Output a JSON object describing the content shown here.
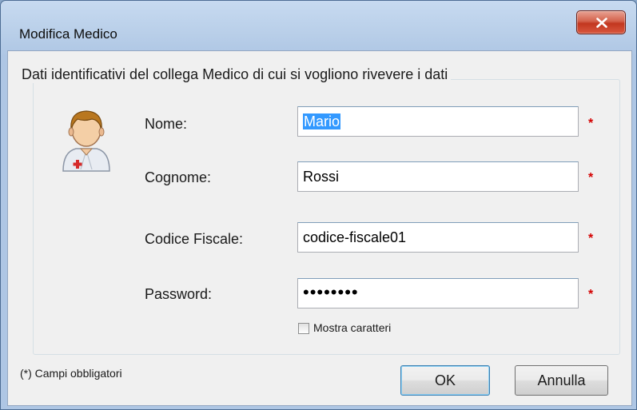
{
  "window": {
    "title": "Modifica Medico",
    "close_glyph": "X"
  },
  "group": {
    "title": "Dati identificativi del collega Medico di cui si vogliono rivevere i dati"
  },
  "avatar": {
    "icon": "doctor-avatar-icon"
  },
  "form": {
    "nome": {
      "label": "Nome:",
      "value": "Mario",
      "selected": true,
      "required_mark": "*"
    },
    "cognome": {
      "label": "Cognome:",
      "value": "Rossi",
      "required_mark": "*"
    },
    "codice_fiscale": {
      "label": "Codice Fiscale:",
      "value": "codice-fiscale01",
      "required_mark": "*"
    },
    "password": {
      "label": "Password:",
      "value": "••••••••",
      "required_mark": "*"
    },
    "show_chars": {
      "label": "Mostra caratteri",
      "checked": false
    }
  },
  "footer": {
    "note": "(*) Campi obbligatori",
    "ok_label": "OK",
    "cancel_label": "Annulla"
  },
  "colors": {
    "required": "#d40000",
    "selection": "#3399ff",
    "close_button": "#c2361f"
  }
}
